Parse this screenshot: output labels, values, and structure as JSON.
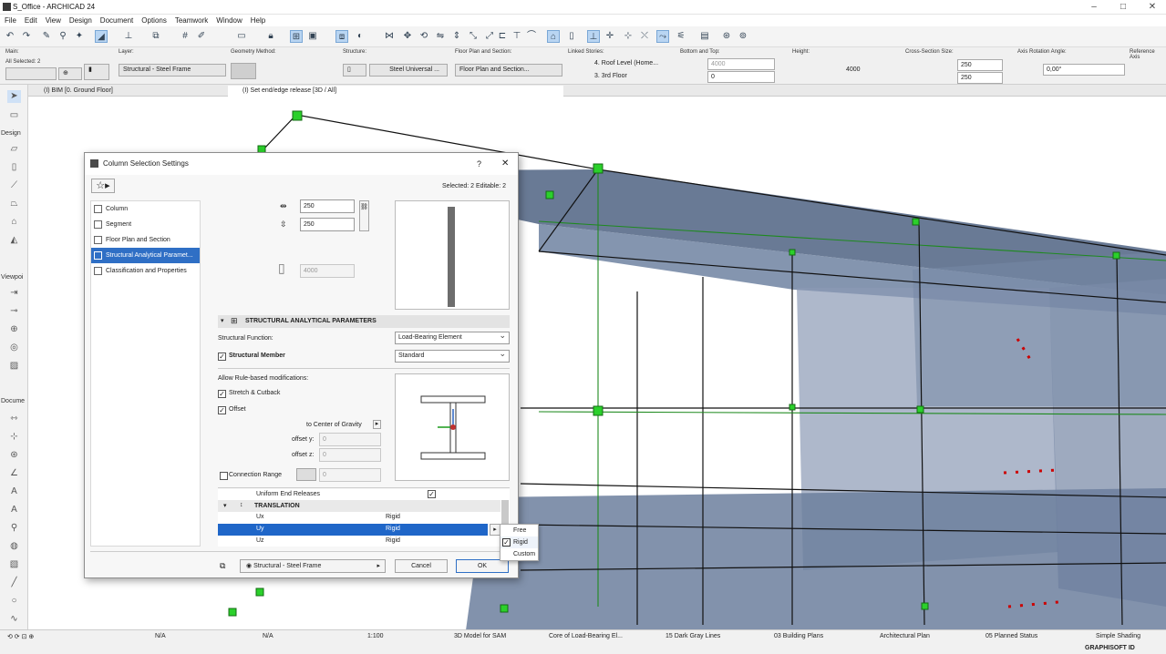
{
  "window": {
    "title": "S_Office - ARCHICAD 24",
    "minimize": "–",
    "maximize": "□",
    "close": "✕"
  },
  "menu": [
    "File",
    "Edit",
    "View",
    "Design",
    "Document",
    "Options",
    "Teamwork",
    "Window",
    "Help"
  ],
  "infobox": {
    "main_label": "Main:",
    "selected": "All Selected: 2",
    "layer_label": "Layer:",
    "layer_value": "Structural - Steel Frame",
    "geometry_label": "Geometry Method:",
    "structure_label": "Structure:",
    "structure_value": "Steel Universal ...",
    "floorplan_label": "Floor Plan and Section:",
    "floorplan_value": "Floor Plan and Section...",
    "linked_label": "Linked Stories:",
    "linked_top": "4. Roof Level (Home...",
    "linked_bottom": "3. 3rd Floor",
    "bottomtop_label": "Bottom and Top:",
    "top_value": "4000",
    "bottom_value": "0",
    "height_label": "Height:",
    "height_value": "4000",
    "cross_label": "Cross-Section Size:",
    "cross_w": "250",
    "cross_h": "250",
    "axis_label": "Axis Rotation Angle:",
    "axis_value": "0,00°",
    "ref_label": "Reference Axis"
  },
  "tabs": {
    "tab1": "(I) BIM [0. Ground Floor]",
    "tab2": "(I) Set end/edge release [3D / All]"
  },
  "toolbox": {
    "design": "Design",
    "viewpoint": "Viewpoi",
    "document": "Docume"
  },
  "dialog": {
    "title": "Column Selection Settings",
    "help": "?",
    "close": "✕",
    "selected_info": "Selected: 2 Editable: 2",
    "nav": [
      "Column",
      "Segment",
      "Floor Plan and Section",
      "Structural Analytical Paramet...",
      "Classification and Properties"
    ],
    "width": "250",
    "depth": "250",
    "height_field": "4000",
    "section_title": "STRUCTURAL ANALYTICAL PARAMETERS",
    "function_label": "Structural Function:",
    "function_value": "Load-Bearing Element",
    "member_label": "Structural Member",
    "member_value": "Standard",
    "rule_label": "Allow Rule-based modifications:",
    "stretch_label": "Stretch & Cutback",
    "offset_label": "Offset",
    "gravity_label": "to Center of Gravity",
    "offset_y_label": "offset y:",
    "offset_y": "0",
    "offset_z_label": "offset z:",
    "offset_z": "0",
    "conn_label": "Connection Range",
    "conn_value": "0",
    "uniform_label": "Uniform End Releases",
    "translation_label": "TRANSLATION",
    "rows": [
      {
        "name": "Ux",
        "value": "Rigid"
      },
      {
        "name": "Uy",
        "value": "Rigid"
      },
      {
        "name": "Uz",
        "value": "Rigid"
      }
    ],
    "layer_value": "Structural - Steel Frame",
    "cancel": "Cancel",
    "ok": "OK"
  },
  "popup": [
    "Free",
    "Rigid",
    "Custom"
  ],
  "status": {
    "na1": "N/A",
    "na2": "N/A",
    "scale": "1:100",
    "model": "3D Model for SAM",
    "core": "Core of Load-Bearing El...",
    "pens": "15 Dark Gray Lines",
    "plans": "03 Building Plans",
    "arch": "Architectural Plan",
    "planned": "05 Planned Status",
    "shading": "Simple Shading",
    "brand": "GRAPHISOFT ID"
  },
  "colors": {
    "accent": "#2f6fc5",
    "node": "#2bd02b",
    "panel": "#5f7394"
  }
}
